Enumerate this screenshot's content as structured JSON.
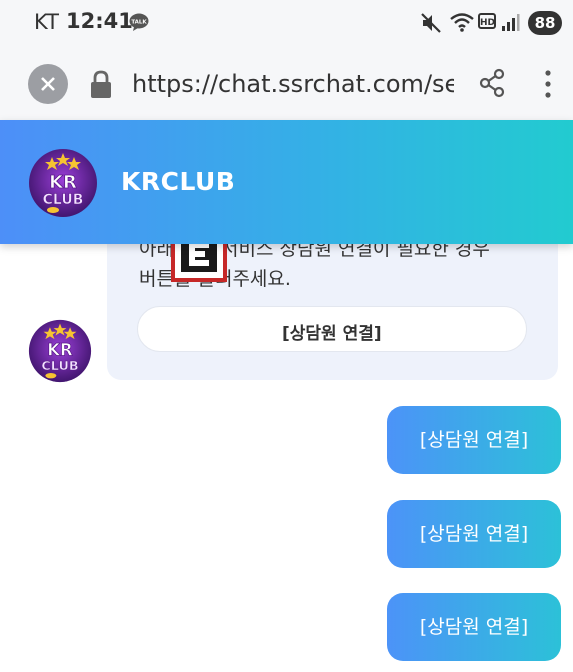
{
  "status_bar": {
    "carrier": "KT",
    "time": "12:41",
    "talk_badge": "TALK",
    "hd_label": "HD",
    "battery": "88"
  },
  "browser": {
    "url": "https://chat.ssrchat.com/serv"
  },
  "chat_header": {
    "title": "KRCLUB"
  },
  "avatar": {
    "line1": "KR",
    "line2": "CLUB"
  },
  "bot_message": {
    "line1": "아래 고객 서비스 상담원 연결이 필요한 경우",
    "line2": "버튼을 눌러주세요.",
    "button_label": "[상담원 연결]"
  },
  "user_messages": [
    "[상담원 연결]",
    "[상담원 연결]",
    "[상담원 연결]"
  ],
  "colors": {
    "header_gradient_start": "#4d8ff8",
    "header_gradient_end": "#22cbd0",
    "bubble_gradient_start": "#4c93f8",
    "bubble_gradient_end": "#2cc1d8",
    "bot_bubble_bg": "#eef2fb"
  }
}
